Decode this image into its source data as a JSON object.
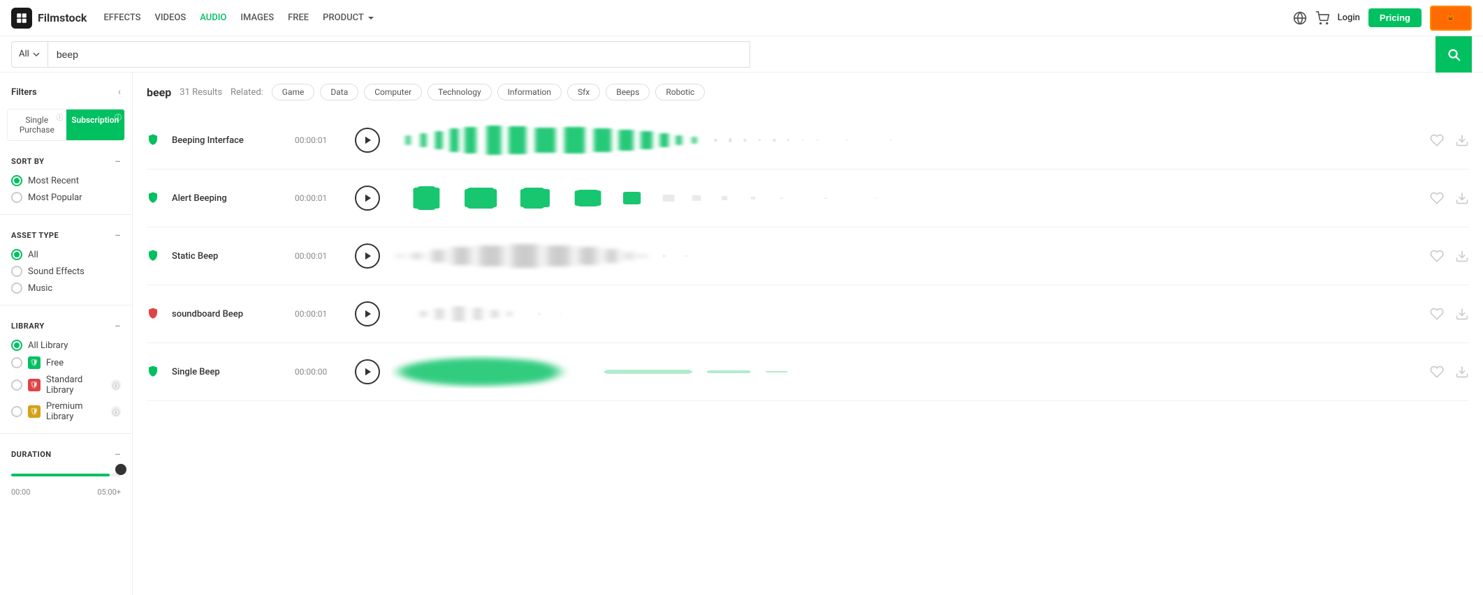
{
  "brand": "Filmstock",
  "nav": {
    "links": [
      "EFFECTS",
      "VIDEOS",
      "AUDIO",
      "IMAGES",
      "FREE",
      "PRODUCT"
    ],
    "active_link": "AUDIO",
    "login_label": "Login",
    "pricing_label": "Pricing",
    "halloween_label": "Halloween"
  },
  "search": {
    "dropdown_value": "All",
    "query": "beep",
    "button_aria": "Search"
  },
  "filters": {
    "title": "Filters",
    "purchase_tabs": [
      "Single Purchase",
      "Subscription"
    ],
    "active_tab": 1,
    "sort_by": {
      "title": "SORT BY",
      "options": [
        "Most Recent",
        "Most Popular"
      ],
      "selected": 0
    },
    "asset_type": {
      "title": "ASSET TYPE",
      "options": [
        "All",
        "Sound Effects",
        "Music"
      ],
      "selected": 0
    },
    "library": {
      "title": "LIBRARY",
      "options": [
        {
          "label": "All Library",
          "icon": "all",
          "selected": true
        },
        {
          "label": "Free",
          "icon": "green"
        },
        {
          "label": "Standard Library",
          "icon": "red"
        },
        {
          "label": "Premium Library",
          "icon": "gold"
        }
      ]
    },
    "duration": {
      "title": "DURATION",
      "min_label": "00:00",
      "max_label": "05:00+"
    }
  },
  "results": {
    "search_term": "beep",
    "count": "31 Results",
    "related_label": "Related:",
    "tags": [
      "Game",
      "Data",
      "Computer",
      "Technology",
      "Information",
      "Sfx",
      "Beeps",
      "Robotic"
    ],
    "tracks": [
      {
        "name": "Beeping Interface",
        "duration": "00:00:01",
        "waveform_type": "green_wide"
      },
      {
        "name": "Alert Beeping",
        "duration": "00:00:01",
        "waveform_type": "green_blocks"
      },
      {
        "name": "Static Beep",
        "duration": "00:00:01",
        "waveform_type": "gray_center"
      },
      {
        "name": "soundboard Beep",
        "duration": "00:00:01",
        "waveform_type": "gray_small"
      },
      {
        "name": "Single Beep",
        "duration": "00:00:00",
        "waveform_type": "green_blob"
      }
    ]
  }
}
